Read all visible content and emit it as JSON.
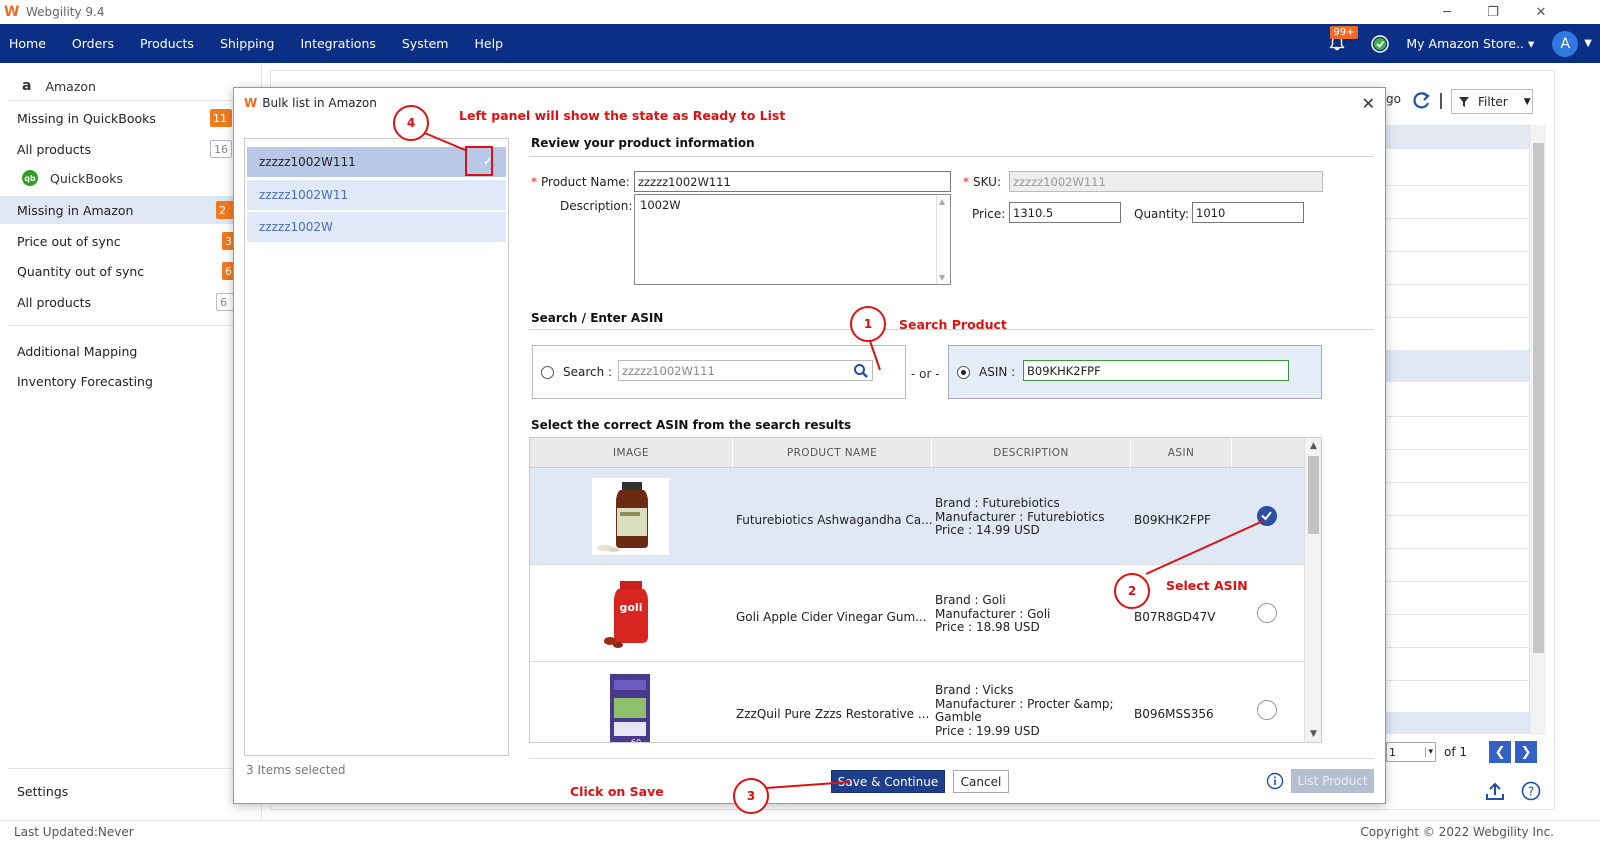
{
  "app": {
    "title": "Webgility 9.4"
  },
  "nav": {
    "items": [
      "Home",
      "Orders",
      "Products",
      "Shipping",
      "Integrations",
      "System",
      "Help"
    ],
    "notif_badge": "99+",
    "store": "My Amazon Store..",
    "avatar": "A"
  },
  "sidebar": {
    "amazon_label": "Amazon",
    "quickbooks_label": "QuickBooks",
    "missing_qb": "Missing in QuickBooks",
    "missing_qb_count": "11",
    "all_products_1": "All products",
    "all_products_1_count": "16",
    "missing_amazon": "Missing in Amazon",
    "missing_amazon_count": "2",
    "price_out": "Price out of sync",
    "price_out_count": "3",
    "qty_out": "Quantity out of sync",
    "qty_out_count": "6",
    "all_products_2": "All products",
    "all_products_2_count": "6",
    "additional_mapping": "Additional Mapping",
    "inventory_forecasting": "Inventory Forecasting",
    "settings": "Settings"
  },
  "background": {
    "go_label": "go",
    "filter_label": "Filter",
    "page_value": "1",
    "page_of": "of 1"
  },
  "status": {
    "last_updated": "Last Updated:Never",
    "copyright": "Copyright © 2022 Webgility Inc."
  },
  "modal": {
    "title": "Bulk list in Amazon",
    "list_items": [
      "zzzzz1002W111",
      "zzzzz1002W11",
      "zzzzz1002W"
    ],
    "items_selected": "3 Items selected",
    "review_title": "Review your product information",
    "product_name_label": "Product Name:",
    "product_name_value": "zzzzz1002W111",
    "sku_label": "SKU:",
    "sku_value": "zzzzz1002W111",
    "description_label": "Description:",
    "description_value": "1002W",
    "price_label": "Price:",
    "price_value": "1310.5",
    "quantity_label": "Quantity:",
    "quantity_value": "1010",
    "search_title": "Search / Enter ASIN",
    "search_label": "Search :",
    "search_value": "zzzzz1002W111",
    "or_label": "- or -",
    "asin_label": "ASIN :",
    "asin_value": "B09KHK2FPF",
    "results_title": "Select the correct ASIN from the search results",
    "columns": [
      "IMAGE",
      "PRODUCT NAME",
      "DESCRIPTION",
      "ASIN"
    ],
    "rows": [
      {
        "name": "Futurebiotics Ashwagandha Ca...",
        "brand": "Brand : Futurebiotics",
        "manufacturer": "Manufacturer : Futurebiotics",
        "manufacturer2": "",
        "price": "Price : 14.99 USD",
        "asin": "B09KHK2FPF",
        "selected": true
      },
      {
        "name": "Goli Apple Cider Vinegar Gum...",
        "brand": "Brand : Goli",
        "manufacturer": "Manufacturer : Goli",
        "manufacturer2": "",
        "price": "Price : 18.98 USD",
        "asin": "B07R8GD47V",
        "selected": false
      },
      {
        "name": "ZzzQuil Pure Zzzs Restorative ...",
        "brand": "Brand : Vicks",
        "manufacturer": "Manufacturer : Procter &amp;",
        "manufacturer2": "Gamble",
        "price": "Price : 19.99 USD",
        "asin": "B096MSS356",
        "selected": false
      }
    ],
    "save_label": "Save & Continue",
    "cancel_label": "Cancel",
    "list_product_label": "List Product"
  },
  "annotations": {
    "n1": "1",
    "t1": "Search Product",
    "n2": "2",
    "t2": "Select ASIN",
    "n3": "3",
    "t3": "Click on Save",
    "n4": "4",
    "t4": "Left panel will show the state as Ready to List"
  },
  "colors": {
    "nav": "#0c2f86",
    "accent": "#f26a21",
    "annotation": "#dd1111",
    "primary_button": "#1f3e8c"
  }
}
